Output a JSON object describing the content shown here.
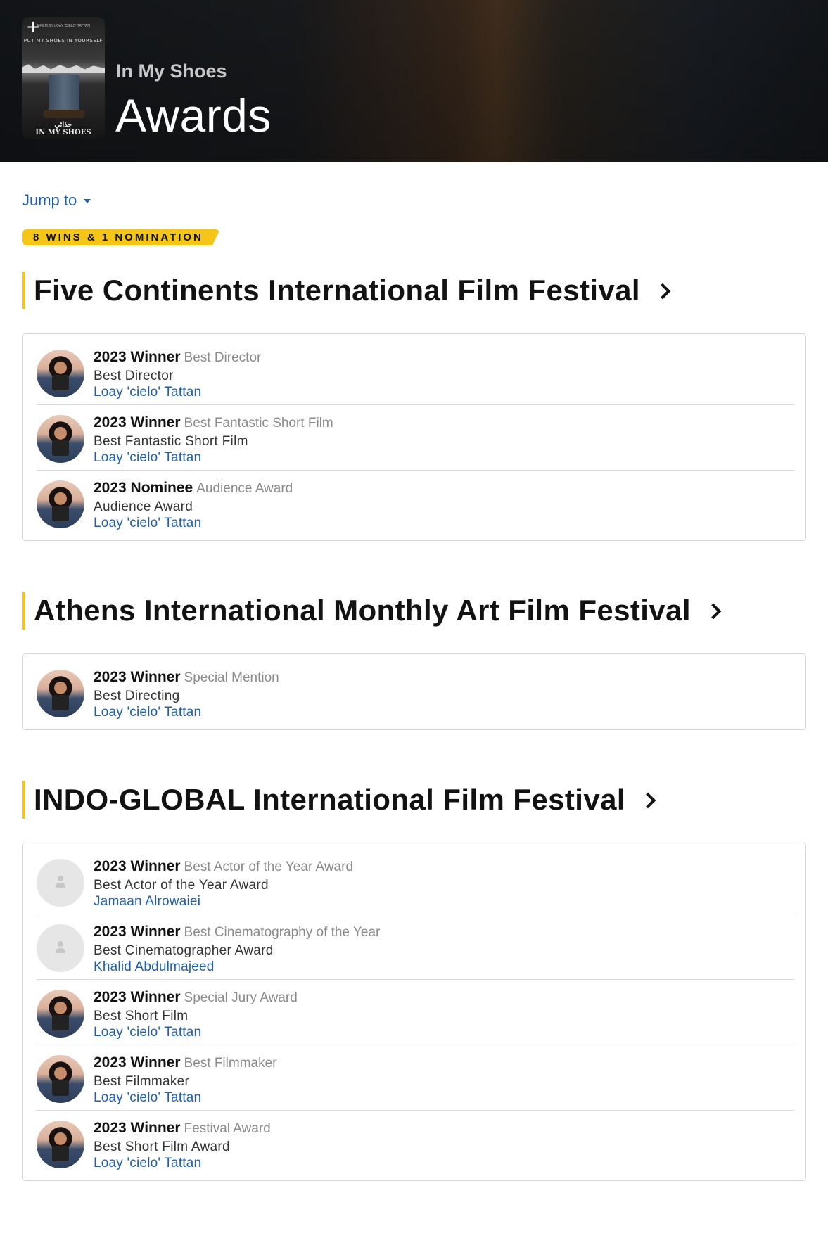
{
  "header": {
    "subtitle": "In My Shoes",
    "title": "Awards",
    "add_label": "+",
    "poster": {
      "top_text": "A FILM BY LOAY 'CIELO' TATTAN",
      "tagline": "PUT MY SHOES IN YOURSELF",
      "title_ar": "حذائي",
      "title_en": "IN MY SHOES"
    }
  },
  "jump_to": "Jump to",
  "summary_badge": "8 WINS & 1 NOMINATION",
  "sections": [
    {
      "title": "Five Continents International Film Festival",
      "awards": [
        {
          "avatar": "photo",
          "outcome": "2023 Winner",
          "category": "Best Director",
          "award": "Best Director",
          "person": "Loay 'cielo' Tattan"
        },
        {
          "avatar": "photo",
          "outcome": "2023 Winner",
          "category": "Best Fantastic Short Film",
          "award": "Best Fantastic Short Film",
          "person": "Loay 'cielo' Tattan"
        },
        {
          "avatar": "photo",
          "outcome": "2023 Nominee",
          "category": "Audience Award",
          "award": "Audience Award",
          "person": "Loay 'cielo' Tattan"
        }
      ]
    },
    {
      "title": "Athens International Monthly Art Film Festival",
      "awards": [
        {
          "avatar": "photo",
          "outcome": "2023 Winner",
          "category": "Special Mention",
          "award": "Best Directing",
          "person": "Loay 'cielo' Tattan"
        }
      ]
    },
    {
      "title": "INDO-GLOBAL International Film Festival",
      "awards": [
        {
          "avatar": "placeholder",
          "outcome": "2023 Winner",
          "category": "Best Actor of the Year Award",
          "award": "Best Actor of the Year Award",
          "person": "Jamaan Alrowaiei"
        },
        {
          "avatar": "placeholder",
          "outcome": "2023 Winner",
          "category": "Best Cinematography of the Year",
          "award": "Best Cinematographer Award",
          "person": "Khalid Abdulmajeed"
        },
        {
          "avatar": "photo",
          "outcome": "2023 Winner",
          "category": "Special Jury Award",
          "award": "Best Short Film",
          "person": "Loay 'cielo' Tattan"
        },
        {
          "avatar": "photo",
          "outcome": "2023 Winner",
          "category": "Best Filmmaker",
          "award": "Best Filmmaker",
          "person": "Loay 'cielo' Tattan"
        },
        {
          "avatar": "photo",
          "outcome": "2023 Winner",
          "category": "Festival Award",
          "award": "Best Short Film Award",
          "person": "Loay 'cielo' Tattan"
        }
      ]
    }
  ],
  "colors": {
    "accent": "#f5c518",
    "link": "#1f5fae",
    "muted": "#8a8a8a"
  }
}
